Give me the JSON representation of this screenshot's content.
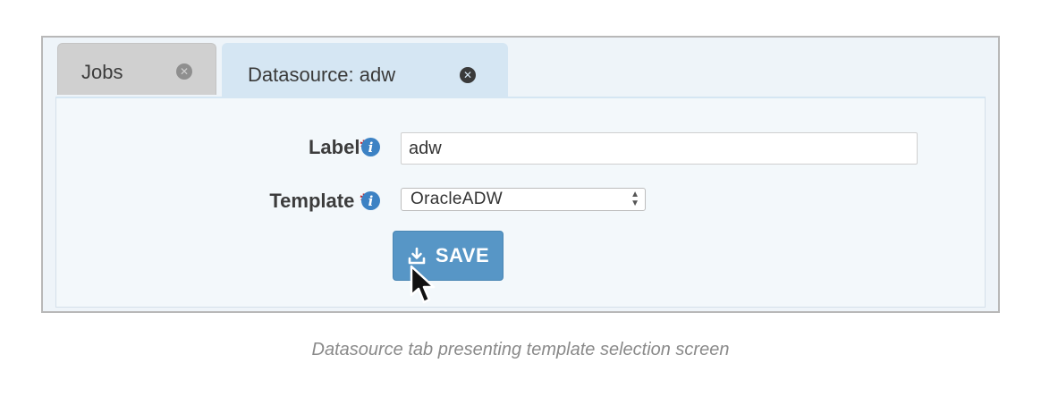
{
  "tabs": [
    {
      "label": "Jobs",
      "close_icon": "close-circle-icon"
    },
    {
      "label": "Datasource: adw",
      "close_icon": "close-circle-icon",
      "active": true
    }
  ],
  "form": {
    "label_field": {
      "label": "Label",
      "required_marker": "*",
      "info_icon": "info-icon",
      "value": "adw"
    },
    "template_field": {
      "label": "Template",
      "required_marker": "*",
      "info_icon": "info-icon",
      "value": "OracleADW"
    },
    "save_button": {
      "label": "SAVE",
      "icon": "download-icon"
    }
  },
  "caption": "Datasource tab presenting template selection screen",
  "colors": {
    "accent": "#5796c6",
    "info": "#3c82c4",
    "required": "#c0282d",
    "active_tab": "#d5e6f3",
    "inactive_tab": "#d0d0d0"
  }
}
